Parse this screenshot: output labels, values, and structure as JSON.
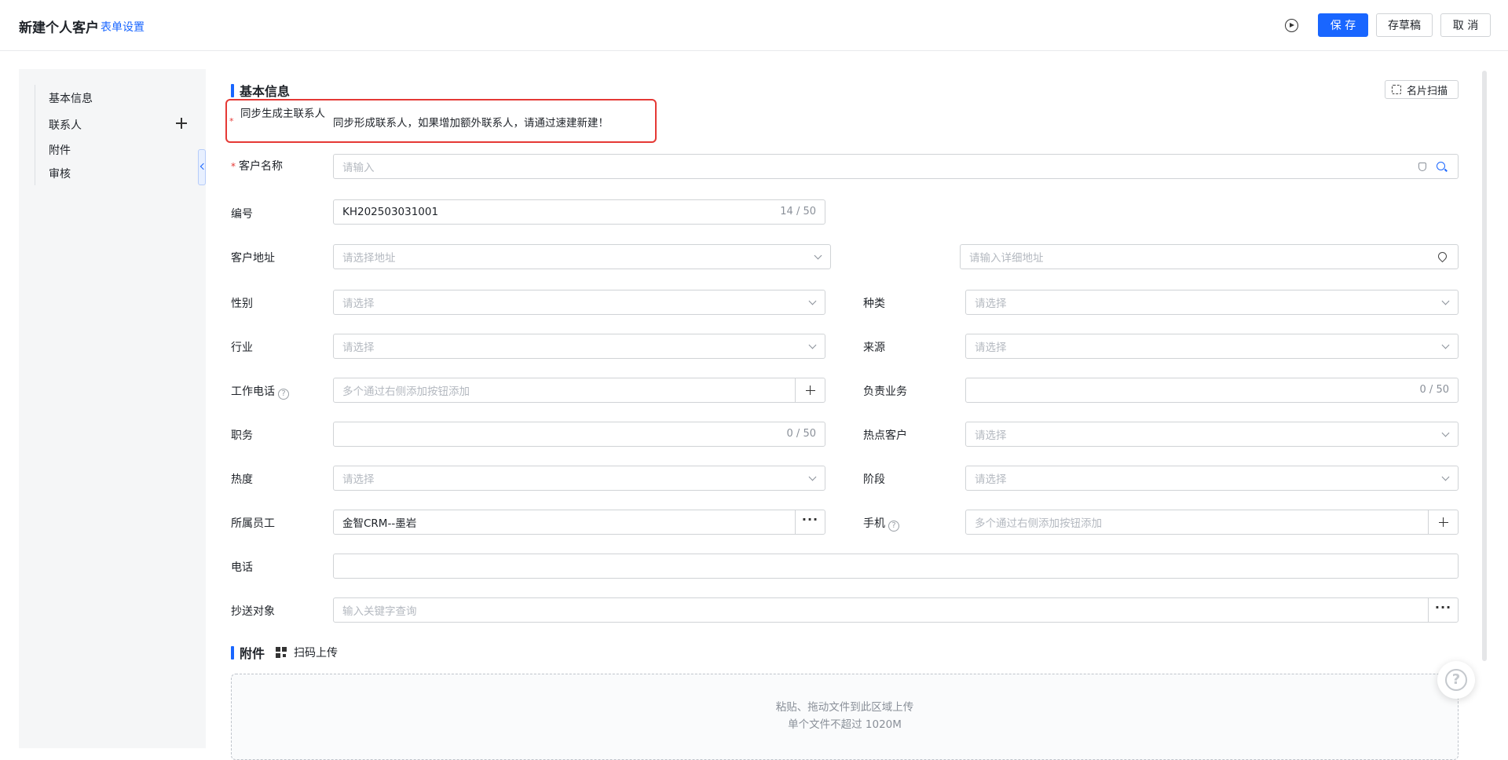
{
  "header": {
    "title": "新建个人客户",
    "form_settings": "表单设置",
    "save": "保 存",
    "draft": "存草稿",
    "cancel": "取 消"
  },
  "nav": {
    "items": [
      "基本信息",
      "联系人",
      "附件",
      "审核"
    ]
  },
  "section_basic": {
    "title": "基本信息",
    "scan_card": "名片扫描"
  },
  "sync": {
    "label": "同步生成主联系人",
    "value": "同步形成联系人，如果增加额外联系人，请通过速建新建！"
  },
  "fields": {
    "customer_name": {
      "label": "客户名称",
      "placeholder": "请输入"
    },
    "number": {
      "label": "编号",
      "value": "KH202503031001",
      "count": "14 / 50"
    },
    "address": {
      "label": "客户地址",
      "placeholder": "请选择地址",
      "detail_placeholder": "请输入详细地址"
    },
    "gender": {
      "label": "性别",
      "placeholder": "请选择"
    },
    "category": {
      "label": "种类",
      "placeholder": "请选择"
    },
    "industry": {
      "label": "行业",
      "placeholder": "请选择"
    },
    "source": {
      "label": "来源",
      "placeholder": "请选择"
    },
    "work_phone": {
      "label": "工作电话",
      "placeholder": "多个通过右侧添加按钮添加"
    },
    "business": {
      "label": "负责业务",
      "count": "0 / 50"
    },
    "position": {
      "label": "职务",
      "count": "0 / 50"
    },
    "hot_customer": {
      "label": "热点客户",
      "placeholder": "请选择"
    },
    "heat": {
      "label": "热度",
      "placeholder": "请选择"
    },
    "stage": {
      "label": "阶段",
      "placeholder": "请选择"
    },
    "employee": {
      "label": "所属员工",
      "value": "金智CRM--墨岩"
    },
    "mobile": {
      "label": "手机",
      "placeholder": "多个通过右侧添加按钮添加"
    },
    "phone": {
      "label": "电话"
    },
    "cc": {
      "label": "抄送对象",
      "placeholder": "输入关键字查询"
    }
  },
  "attachments": {
    "title": "附件",
    "qr_upload": "扫码上传",
    "drop_text": "粘贴、拖动文件到此区域上传",
    "limit_text": "单个文件不超过 1020M"
  },
  "icons": {
    "help": "?",
    "more": "···"
  },
  "colors": {
    "primary": "#1966ff",
    "required": "#e53935",
    "highlight_border": "#e53935"
  }
}
